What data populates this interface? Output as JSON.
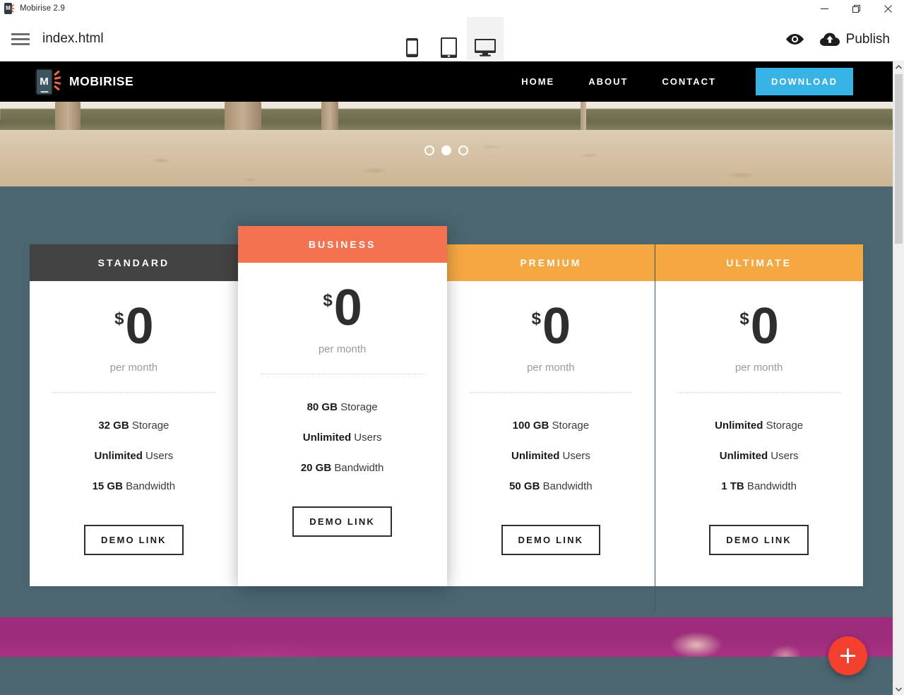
{
  "window": {
    "title": "Mobirise 2.9",
    "app_icon": "mobirise-logo-icon",
    "minimize": "minimize-icon",
    "maximize": "restore-icon",
    "close": "close-icon"
  },
  "toolbar": {
    "menu_icon": "hamburger-icon",
    "document_name": "index.html",
    "devices": [
      {
        "name": "mobile",
        "icon": "phone-icon",
        "active": false
      },
      {
        "name": "tablet",
        "icon": "tablet-icon",
        "active": false
      },
      {
        "name": "desktop",
        "icon": "desktop-icon",
        "active": true
      }
    ],
    "preview_icon": "eye-icon",
    "publish_icon": "cloud-upload-icon",
    "publish_label": "Publish"
  },
  "site": {
    "navbar": {
      "brand_name": "MOBIRISE",
      "brand_logo": "mobirise-phone-logo-icon",
      "background": "#000000",
      "links": [
        {
          "label": "HOME"
        },
        {
          "label": "ABOUT"
        },
        {
          "label": "CONTACT"
        }
      ],
      "cta": {
        "label": "DOWNLOAD",
        "color": "#37b3e6"
      }
    },
    "hero": {
      "alt": "beach sand with palm trunks",
      "dots": [
        {
          "active": false
        },
        {
          "active": true
        },
        {
          "active": false
        }
      ]
    },
    "pricing": {
      "background": "#4b6670",
      "currency": "$",
      "period": "per month",
      "cta_label": "DEMO LINK",
      "plans": [
        {
          "name": "STANDARD",
          "header_color": "#434343",
          "price": "0",
          "featured": false,
          "features": [
            {
              "value": "32 GB",
              "label": " Storage"
            },
            {
              "value": "Unlimited",
              "label": " Users"
            },
            {
              "value": "15 GB",
              "label": " Bandwidth"
            }
          ]
        },
        {
          "name": "BUSINESS",
          "header_color": "#f4724f",
          "price": "0",
          "featured": true,
          "features": [
            {
              "value": "80 GB",
              "label": " Storage"
            },
            {
              "value": "Unlimited",
              "label": " Users"
            },
            {
              "value": "20 GB",
              "label": " Bandwidth"
            }
          ]
        },
        {
          "name": "PREMIUM",
          "header_color": "#f5a742",
          "price": "0",
          "featured": false,
          "features": [
            {
              "value": "100 GB",
              "label": " Storage"
            },
            {
              "value": "Unlimited",
              "label": " Users"
            },
            {
              "value": "50 GB",
              "label": " Bandwidth"
            }
          ]
        },
        {
          "name": "ULTIMATE",
          "header_color": "#f5a742",
          "price": "0",
          "featured": false,
          "features": [
            {
              "value": "Unlimited",
              "label": " Storage"
            },
            {
              "value": "Unlimited",
              "label": " Users"
            },
            {
              "value": "1 TB",
              "label": " Bandwidth"
            }
          ]
        }
      ]
    },
    "bottom_section": {
      "alt": "magenta toned photo band"
    }
  },
  "add_block": {
    "icon": "plus-icon",
    "color": "#f4402e"
  },
  "scrollbar": {
    "up_icon": "chevron-up-icon",
    "down_icon": "chevron-down-icon"
  }
}
